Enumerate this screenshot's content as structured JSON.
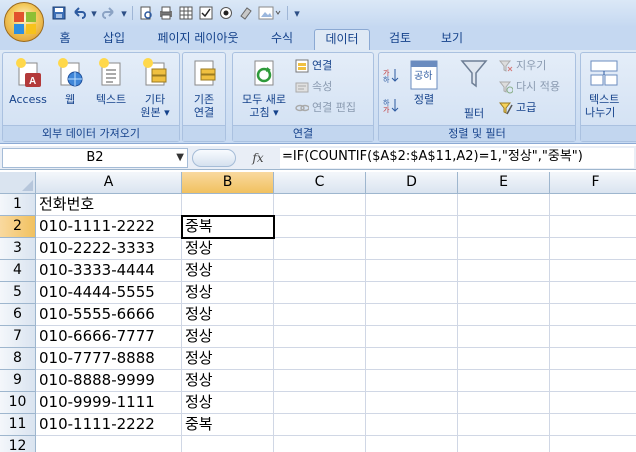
{
  "tabs": [
    "홈",
    "삽입",
    "페이지 레이아웃",
    "수식",
    "데이터",
    "검토",
    "보기"
  ],
  "active_tab": "데이터",
  "ribbon": {
    "external": {
      "label": "외부 데이터 가져오기",
      "access": "Access",
      "web": "웹",
      "text": "텍스트",
      "other_line1": "기타",
      "other_line2": "원본"
    },
    "existing": {
      "line1": "기존",
      "line2": "연결"
    },
    "connections": {
      "label": "연결",
      "refresh_line1": "모두 새로",
      "refresh_line2": "고침",
      "connect": "연결",
      "properties": "속성",
      "edit_links": "연결 편집"
    },
    "sort_filter": {
      "label": "정렬 및 필터",
      "sort": "정렬",
      "filter": "필터",
      "clear": "지우기",
      "reapply": "다시 적용",
      "advanced": "고급",
      "sort_icon_text": "공하"
    },
    "data_tools": {
      "line1": "텍스트",
      "line2": "나누기"
    }
  },
  "formula_bar": {
    "name_box": "B2",
    "fx": "fx",
    "formula": "=IF(COUNTIF($A$2:$A$11,A2)=1,\"정상\",\"중복\")"
  },
  "columns": [
    "A",
    "B",
    "C",
    "D",
    "E",
    "F"
  ],
  "row_numbers": [
    "1",
    "2",
    "3",
    "4",
    "5",
    "6",
    "7",
    "8",
    "9",
    "10",
    "11",
    "12"
  ],
  "rows": [
    [
      "전화번호",
      ""
    ],
    [
      "010-1111-2222",
      "중복"
    ],
    [
      "010-2222-3333",
      "정상"
    ],
    [
      "010-3333-4444",
      "정상"
    ],
    [
      "010-4444-5555",
      "정상"
    ],
    [
      "010-5555-6666",
      "정상"
    ],
    [
      "010-6666-7777",
      "정상"
    ],
    [
      "010-7777-8888",
      "정상"
    ],
    [
      "010-8888-9999",
      "정상"
    ],
    [
      "010-9999-1111",
      "정상"
    ],
    [
      "010-1111-2222",
      "중복"
    ],
    [
      "",
      ""
    ]
  ]
}
